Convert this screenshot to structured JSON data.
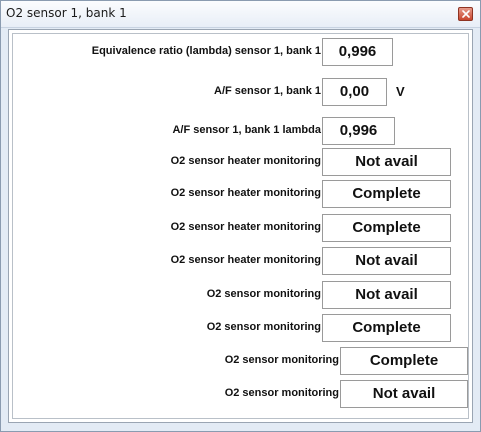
{
  "window": {
    "title": "O2 sensor 1, bank 1",
    "close_glyph": "close-icon"
  },
  "rows": [
    {
      "label": "Equivalence ratio (lambda) sensor 1, bank 1",
      "value": "0,996",
      "unit": ""
    },
    {
      "label": "A/F sensor 1, bank 1",
      "value": "0,00",
      "unit": "V"
    },
    {
      "label": "A/F sensor 1, bank 1 lambda",
      "value": "0,996",
      "unit": ""
    },
    {
      "label": "O2 sensor heater monitoring",
      "value": "Not avail",
      "unit": ""
    },
    {
      "label": "O2 sensor heater monitoring",
      "value": "Complete",
      "unit": ""
    },
    {
      "label": "O2 sensor heater monitoring",
      "value": "Complete",
      "unit": ""
    },
    {
      "label": "O2 sensor heater monitoring",
      "value": "Not avail",
      "unit": ""
    },
    {
      "label": "O2 sensor monitoring",
      "value": "Not avail",
      "unit": ""
    },
    {
      "label": "O2 sensor monitoring",
      "value": "Complete",
      "unit": ""
    },
    {
      "label": "O2 sensor monitoring",
      "value": "Complete",
      "unit": ""
    },
    {
      "label": "O2 sensor monitoring",
      "value": "Not avail",
      "unit": ""
    }
  ]
}
